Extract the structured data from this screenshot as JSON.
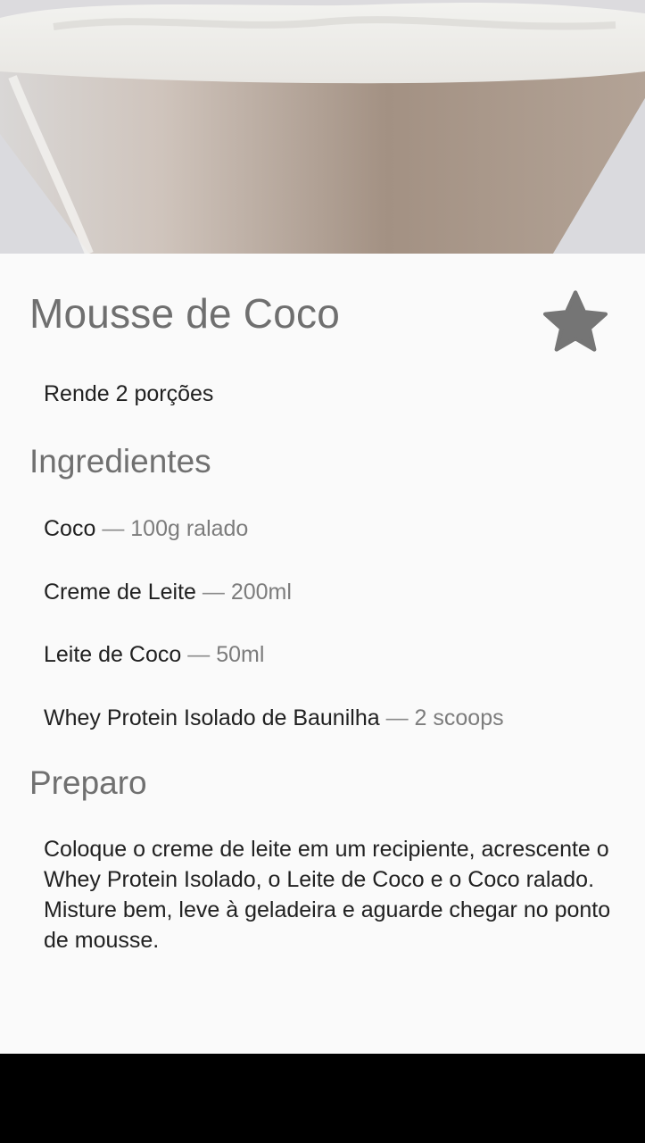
{
  "recipe": {
    "image_alt": "Mousse de Coco",
    "title": "Mousse de Coco",
    "yield": "Rende 2 porções",
    "ingredients_heading": "Ingredientes",
    "ingredients": [
      {
        "name": "Coco",
        "separator": "—",
        "quantity": "100g ralado"
      },
      {
        "name": "Creme de Leite",
        "separator": "—",
        "quantity": "200ml"
      },
      {
        "name": "Leite de Coco",
        "separator": "—",
        "quantity": "50ml"
      },
      {
        "name": "Whey Protein Isolado de Baunilha",
        "separator": "—",
        "quantity": "2 scoops"
      }
    ],
    "method_heading": "Preparo",
    "method": "Coloque o creme de leite em um recipiente, acrescente o Whey Protein Isolado, o Leite de Coco e o Coco ralado. Misture bem, leve à geladeira e aguarde chegar no ponto de mousse."
  },
  "favorite_icon": "star-icon",
  "colors": {
    "background": "#fafafa",
    "title": "#6f6f6f",
    "body_text": "#212121",
    "quantity_text": "#7c7c7c",
    "star": "#757575",
    "nav_bar": "#000000"
  }
}
